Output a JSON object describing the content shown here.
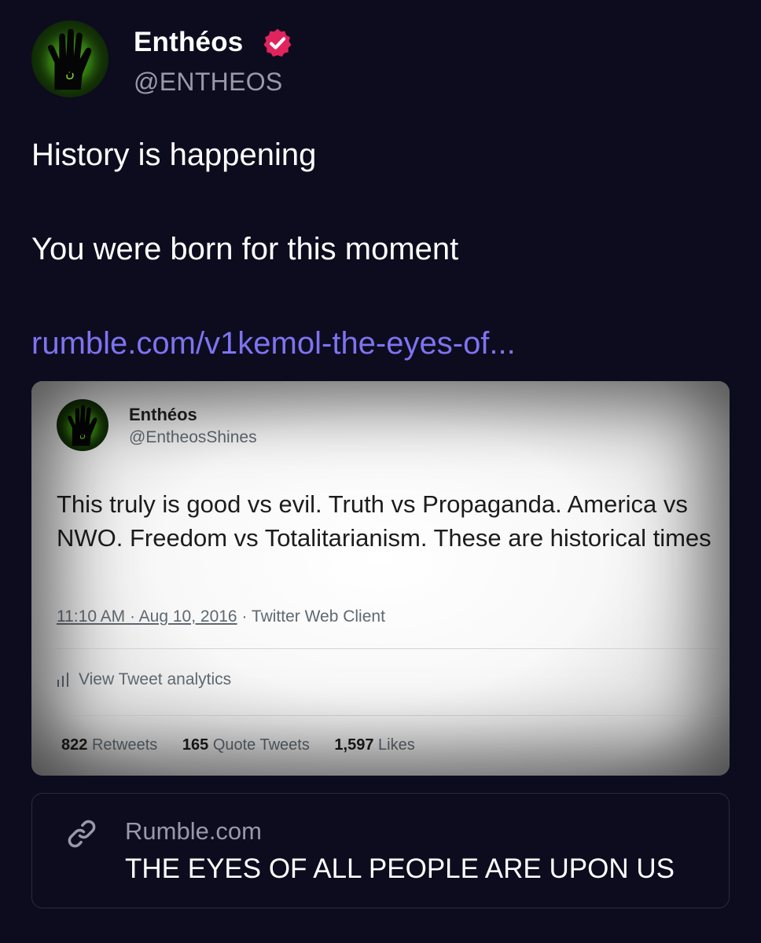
{
  "author": {
    "display_name": "Enthéos",
    "handle": "@ENTHEOS",
    "verified_icon": "verified-badge-icon",
    "accent_color": "#e0245e"
  },
  "post": {
    "line1": "History is happening",
    "line2": "You were born for this moment",
    "link_text": "rumble.com/v1kemol-the-eyes-of..."
  },
  "embedded_tweet": {
    "display_name": "Enthéos",
    "handle": "@EntheosShines",
    "text": "This truly is good vs evil.  Truth vs Propaganda.  America vs NWO.  Freedom vs Totalitarianism.  These are historical times",
    "timestamp": "11:10 AM · Aug 10, 2016",
    "client": " · Twitter Web Client",
    "analytics_label": "View Tweet analytics",
    "retweets_count": "822",
    "retweets_label": "Retweets",
    "quotes_count": "165",
    "quotes_label": "Quote Tweets",
    "likes_count": "1,597",
    "likes_label": "Likes"
  },
  "link_card": {
    "icon": "link-icon",
    "domain": "Rumble.com",
    "title": "THE EYES OF ALL PEOPLE ARE UPON US"
  },
  "colors": {
    "background": "#0d0b1e",
    "link": "#7d74f0",
    "muted": "#9a98a8"
  }
}
